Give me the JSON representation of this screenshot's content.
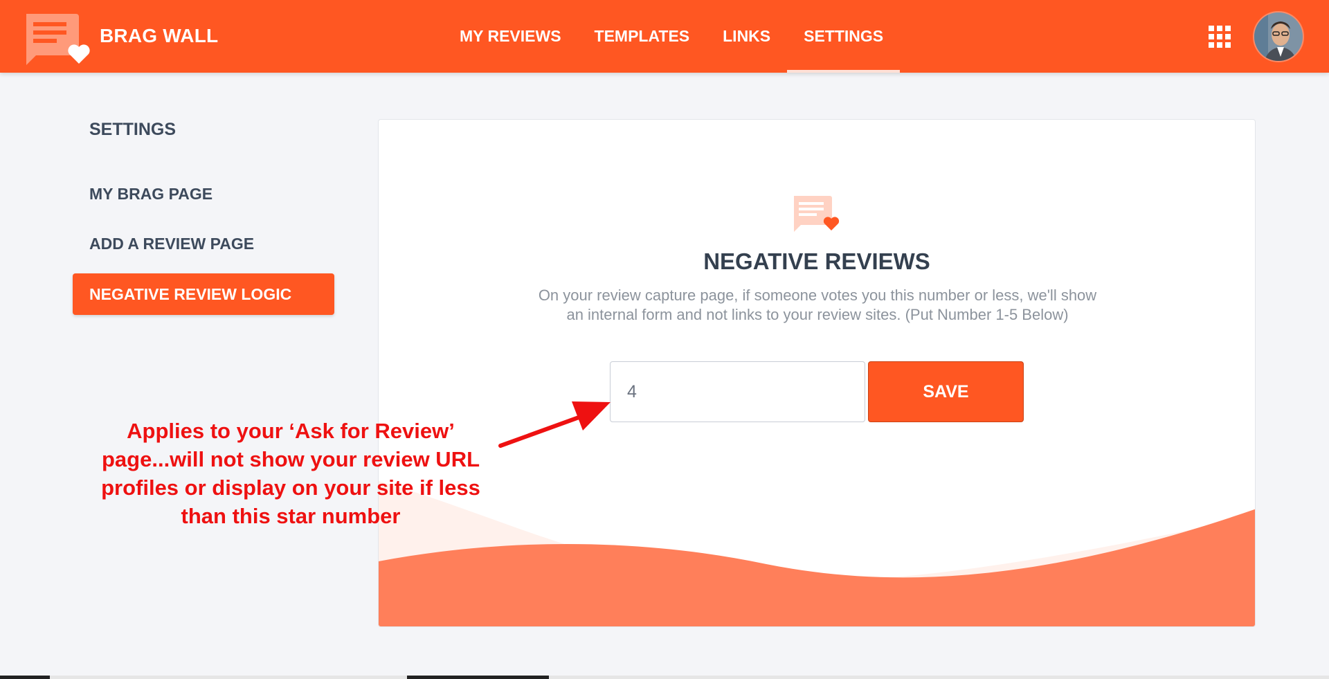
{
  "app": {
    "brand": "BRAG WALL",
    "accent_color": "#ff5722"
  },
  "nav": {
    "items": [
      {
        "label": "MY REVIEWS",
        "active": false
      },
      {
        "label": "TEMPLATES",
        "active": false
      },
      {
        "label": "LINKS",
        "active": false
      },
      {
        "label": "SETTINGS",
        "active": true
      }
    ],
    "apps_icon": "grid-icon",
    "avatar_icon": "user-avatar"
  },
  "sidebar": {
    "title": "SETTINGS",
    "items": [
      {
        "label": "MY BRAG PAGE",
        "active": false
      },
      {
        "label": "ADD A REVIEW PAGE",
        "active": false
      },
      {
        "label": "NEGATIVE REVIEW LOGIC",
        "active": true
      }
    ]
  },
  "card": {
    "icon": "chat-heart-icon",
    "title": "NEGATIVE REVIEWS",
    "description": "On your review capture page, if someone votes you this number or less, we'll show an internal form and not links to your review sites. (Put Number 1-5 Below)",
    "input_value": "4",
    "save_label": "SAVE"
  },
  "annotation": {
    "lines": [
      "Applies to your ‘Ask for Review’",
      "page...will not show your review URL",
      "profiles or display on your site if less",
      "than this star number"
    ],
    "color": "#ee1111"
  }
}
